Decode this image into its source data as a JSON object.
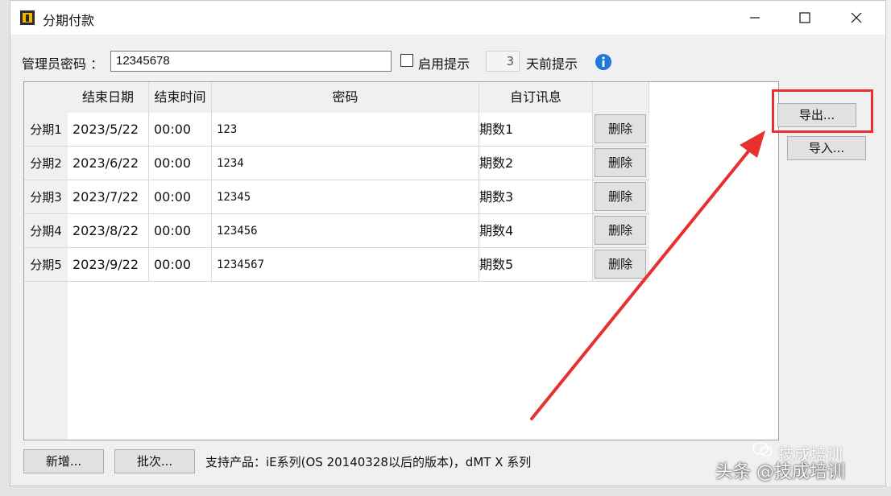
{
  "window": {
    "title": "分期付款"
  },
  "admin": {
    "password_label": "管理员密码 ：",
    "password_value": "12345678",
    "enable_hint_label": "启用提示",
    "enable_hint_checked": false,
    "days_value": "3",
    "days_suffix": "天前提示"
  },
  "table": {
    "headers": [
      "结束日期",
      "结束时间",
      "密码",
      "自订讯息"
    ],
    "rows": [
      {
        "label": "分期1",
        "end_date": "2023/5/22",
        "end_time": "00:00",
        "password": "123",
        "message": "期数1",
        "delete": "删除"
      },
      {
        "label": "分期2",
        "end_date": "2023/6/22",
        "end_time": "00:00",
        "password": "1234",
        "message": "期数2",
        "delete": "删除"
      },
      {
        "label": "分期3",
        "end_date": "2023/7/22",
        "end_time": "00:00",
        "password": "12345",
        "message": "期数3",
        "delete": "删除"
      },
      {
        "label": "分期4",
        "end_date": "2023/8/22",
        "end_time": "00:00",
        "password": "123456",
        "message": "期数4",
        "delete": "删除"
      },
      {
        "label": "分期5",
        "end_date": "2023/9/22",
        "end_time": "00:00",
        "password": "1234567",
        "message": "期数5",
        "delete": "删除"
      }
    ]
  },
  "side": {
    "export_label": "导出...",
    "import_label": "导入..."
  },
  "bottom": {
    "add_label": "新增...",
    "batch_label": "批次...",
    "support_text": "支持产品：iE系列(OS 20140328以后的版本)，dMT X 系列"
  },
  "watermark": {
    "small": "技成培训",
    "main": "头条 @技成培训"
  },
  "colors": {
    "highlight": "#e83030",
    "info_icon": "#1e78d7"
  }
}
